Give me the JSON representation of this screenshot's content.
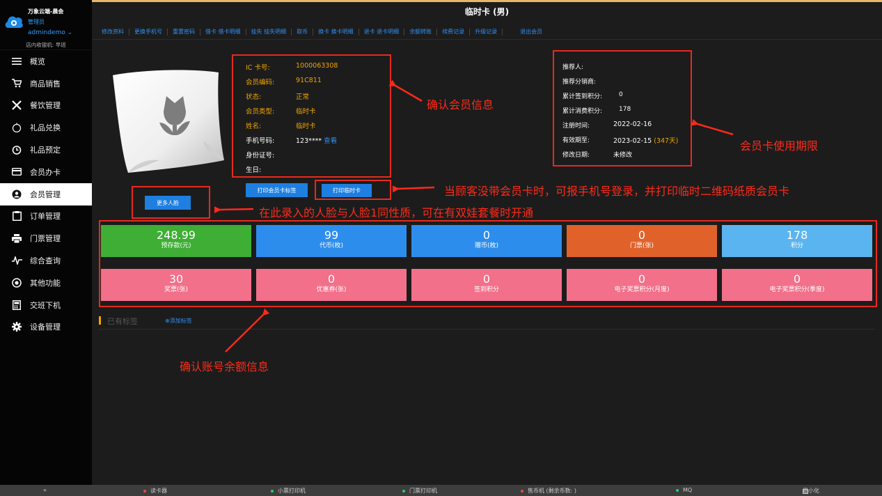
{
  "brand": {
    "company": "万象云端-晨会",
    "role": "管理员",
    "user": "admindemo ⌄",
    "cashier": "店内收银机: 早班"
  },
  "sidebar": {
    "items": [
      {
        "label": "概览",
        "icon": "menu-icon"
      },
      {
        "label": "商品销售",
        "icon": "cart-icon"
      },
      {
        "label": "餐饮管理",
        "icon": "utensils-icon"
      },
      {
        "label": "礼品兑换",
        "icon": "gift-icon"
      },
      {
        "label": "礼品预定",
        "icon": "clock-icon"
      },
      {
        "label": "会员办卡",
        "icon": "card-icon"
      },
      {
        "label": "会员管理",
        "icon": "user-icon",
        "active": true
      },
      {
        "label": "订单管理",
        "icon": "clipboard-icon"
      },
      {
        "label": "门票管理",
        "icon": "printer-icon"
      },
      {
        "label": "综合查询",
        "icon": "pulse-icon"
      },
      {
        "label": "其他功能",
        "icon": "globe-icon"
      },
      {
        "label": "交班下机",
        "icon": "calculator-icon"
      },
      {
        "label": "设备管理",
        "icon": "gear-icon"
      }
    ]
  },
  "header": {
    "title": "临时卡 (男)",
    "accent": "#e8b66a"
  },
  "toolbar": {
    "links": [
      "修改资料",
      "更换手机号",
      "重置密码",
      "借卡 借卡明细",
      "挂失 挂失明细",
      "取币",
      "换卡 换卡明细",
      "退卡 退卡明细",
      "余额转账",
      "续费记录",
      "升级记录",
      "退出会员"
    ]
  },
  "member": {
    "ic_label": "IC 卡号:",
    "ic_value": "1000063308",
    "code_label": "会员编码:",
    "code_value": "91C811",
    "status_label": "状态:",
    "status_value": "正常",
    "type_label": "会员类型:",
    "type_value": "临时卡",
    "name_label": "姓名:",
    "name_value": "临时卡",
    "phone_label": "手机号码:",
    "phone_value": "123****",
    "phone_link": "查看",
    "id_label": "身份证号:",
    "birthday_label": "生日:"
  },
  "referral": {
    "referrer_label": "推荐人:",
    "distributor_label": "推荐分销商:",
    "signin_points_label": "累计签到积分:",
    "signin_points_value": "0",
    "consume_points_label": "累计消费积分:",
    "consume_points_value": "178",
    "register_label": "注册时间:",
    "register_value": "2022-02-16",
    "valid_label": "有效期至:",
    "valid_value": "2023-02-15",
    "valid_days": "(347天)",
    "modify_label": "修改日期:",
    "modify_value": "未修改"
  },
  "buttons": {
    "print_label": "打印会员卡标签",
    "print_temp": "打印临时卡",
    "more_faces": "更多人脸"
  },
  "annotations": {
    "confirm_member": "确认会员信息",
    "card_validity": "会员卡使用期限",
    "no_card": "当顾客没带会员卡时，可报手机号登录，并打印临时二维码纸质会员卡",
    "face_note": "在此录入的人脸与人脸1同性质，可在有双娃套餐时开通",
    "confirm_balance": "确认账号余额信息"
  },
  "stats": [
    {
      "value": "248.99",
      "label": "预存款(元)",
      "color": "#3eae34"
    },
    {
      "value": "99",
      "label": "代币(枚)",
      "color": "#2d8ded"
    },
    {
      "value": "0",
      "label": "赠币(枚)",
      "color": "#2d8ded"
    },
    {
      "value": "0",
      "label": "门票(张)",
      "color": "#e0622a"
    },
    {
      "value": "178",
      "label": "积分",
      "color": "#5ab4f0"
    },
    {
      "value": "30",
      "label": "奖票(张)",
      "color": "#f2708a"
    },
    {
      "value": "0",
      "label": "优惠券(张)",
      "color": "#f2708a"
    },
    {
      "value": "0",
      "label": "签到积分",
      "color": "#f2708a"
    },
    {
      "value": "0",
      "label": "电子奖票积分(月度)",
      "color": "#f2708a"
    },
    {
      "value": "0",
      "label": "电子奖票积分(季度)",
      "color": "#f2708a"
    }
  ],
  "tags": {
    "title": "已有标签",
    "add": "⊕添加标签"
  },
  "statusbar": {
    "collapse": "«",
    "card_reader": "读卡器",
    "receipt_printer": "小票打印机",
    "ticket_printer": "门票打印机",
    "coin_machine": "售币机 (剩余币数: )",
    "mq": "MQ",
    "minimize": "最小化",
    "red": "#e84c3d",
    "green": "#2ecc71"
  }
}
